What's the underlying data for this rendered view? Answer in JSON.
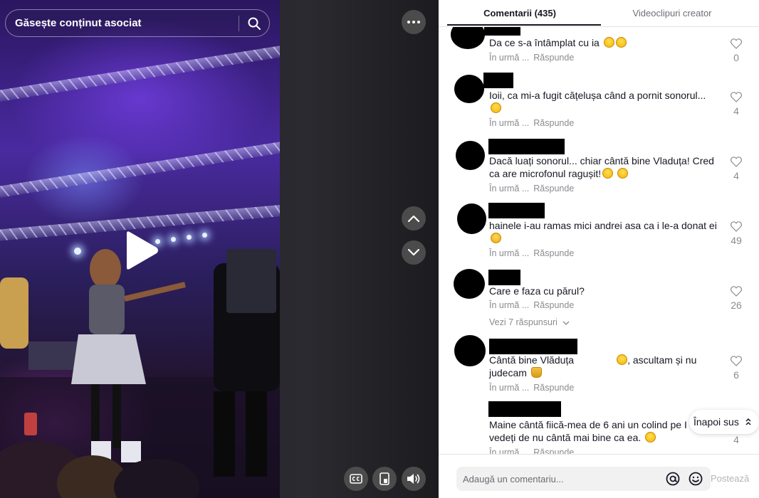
{
  "search": {
    "placeholder": "Găsește conținut asociat"
  },
  "tabs": [
    {
      "label": "Comentarii (435)",
      "active": true
    },
    {
      "label": "Videoclipuri creator",
      "active": false
    }
  ],
  "comments": [
    {
      "text": "Da ce s-a întâmplat cu ia",
      "emojis": [
        "sweat-smile",
        "joy"
      ],
      "time": "În urmă ...",
      "reply_label": "Răspunde",
      "likes": "0"
    },
    {
      "text": "Ioii, ca mi-a fugit cățelușa când a pornit sonorul...",
      "emojis": [
        "grimace"
      ],
      "time": "În urmă ...",
      "reply_label": "Răspunde",
      "likes": "4"
    },
    {
      "text": "Dacă luați sonorul... chiar cântă bine Vladuța! Cred ca are microfonul ragușit!",
      "emojis": [
        "rofl",
        "rofl"
      ],
      "time": "În urmă ...",
      "reply_label": "Răspunde",
      "likes": "4"
    },
    {
      "text": "hainele i-au ramas mici andrei asa ca i le-a donat ei",
      "emojis": [
        "sad"
      ],
      "time": "În urmă ...",
      "reply_label": "Răspunde",
      "likes": "49"
    },
    {
      "text": "Care e faza cu părul?",
      "emojis": [],
      "time": "În urmă ...",
      "reply_label": "Răspunde",
      "likes": "26",
      "view_replies": "Vezi 7 răspunsuri"
    },
    {
      "text_before": "Cântă bine Vlăduța",
      "text_after": ", ascultam și nu judecam",
      "emojis": [
        "joy",
        "pray"
      ],
      "time": "În urmă ...",
      "reply_label": "Răspunde",
      "likes": "6"
    },
    {
      "text": "Maine cântă fiică-mea de 6 ani un colind pe I Tv să vedeți de nu cântă mai bine ca ea.",
      "emojis": [
        "smile"
      ],
      "time": "În urmă ...",
      "reply_label": "Răspunde",
      "likes": "4"
    }
  ],
  "back_to_top": {
    "label": "Înapoi sus"
  },
  "composer": {
    "placeholder": "Adaugă un comentariu...",
    "post_label": "Postează"
  },
  "icons": {
    "search": "search-icon",
    "more": "more-dots-icon",
    "prev": "chevron-up-icon",
    "next": "chevron-down-icon",
    "cc": "closed-captions-icon",
    "float": "floating-player-icon",
    "volume": "volume-icon",
    "like": "heart-outline-icon",
    "mention": "at-sign-icon",
    "emoji": "emoji-icon",
    "play": "play-icon"
  },
  "colors": {
    "text": "#161823",
    "muted": "#8a8b91",
    "post_disabled": "#b4b5ba"
  }
}
